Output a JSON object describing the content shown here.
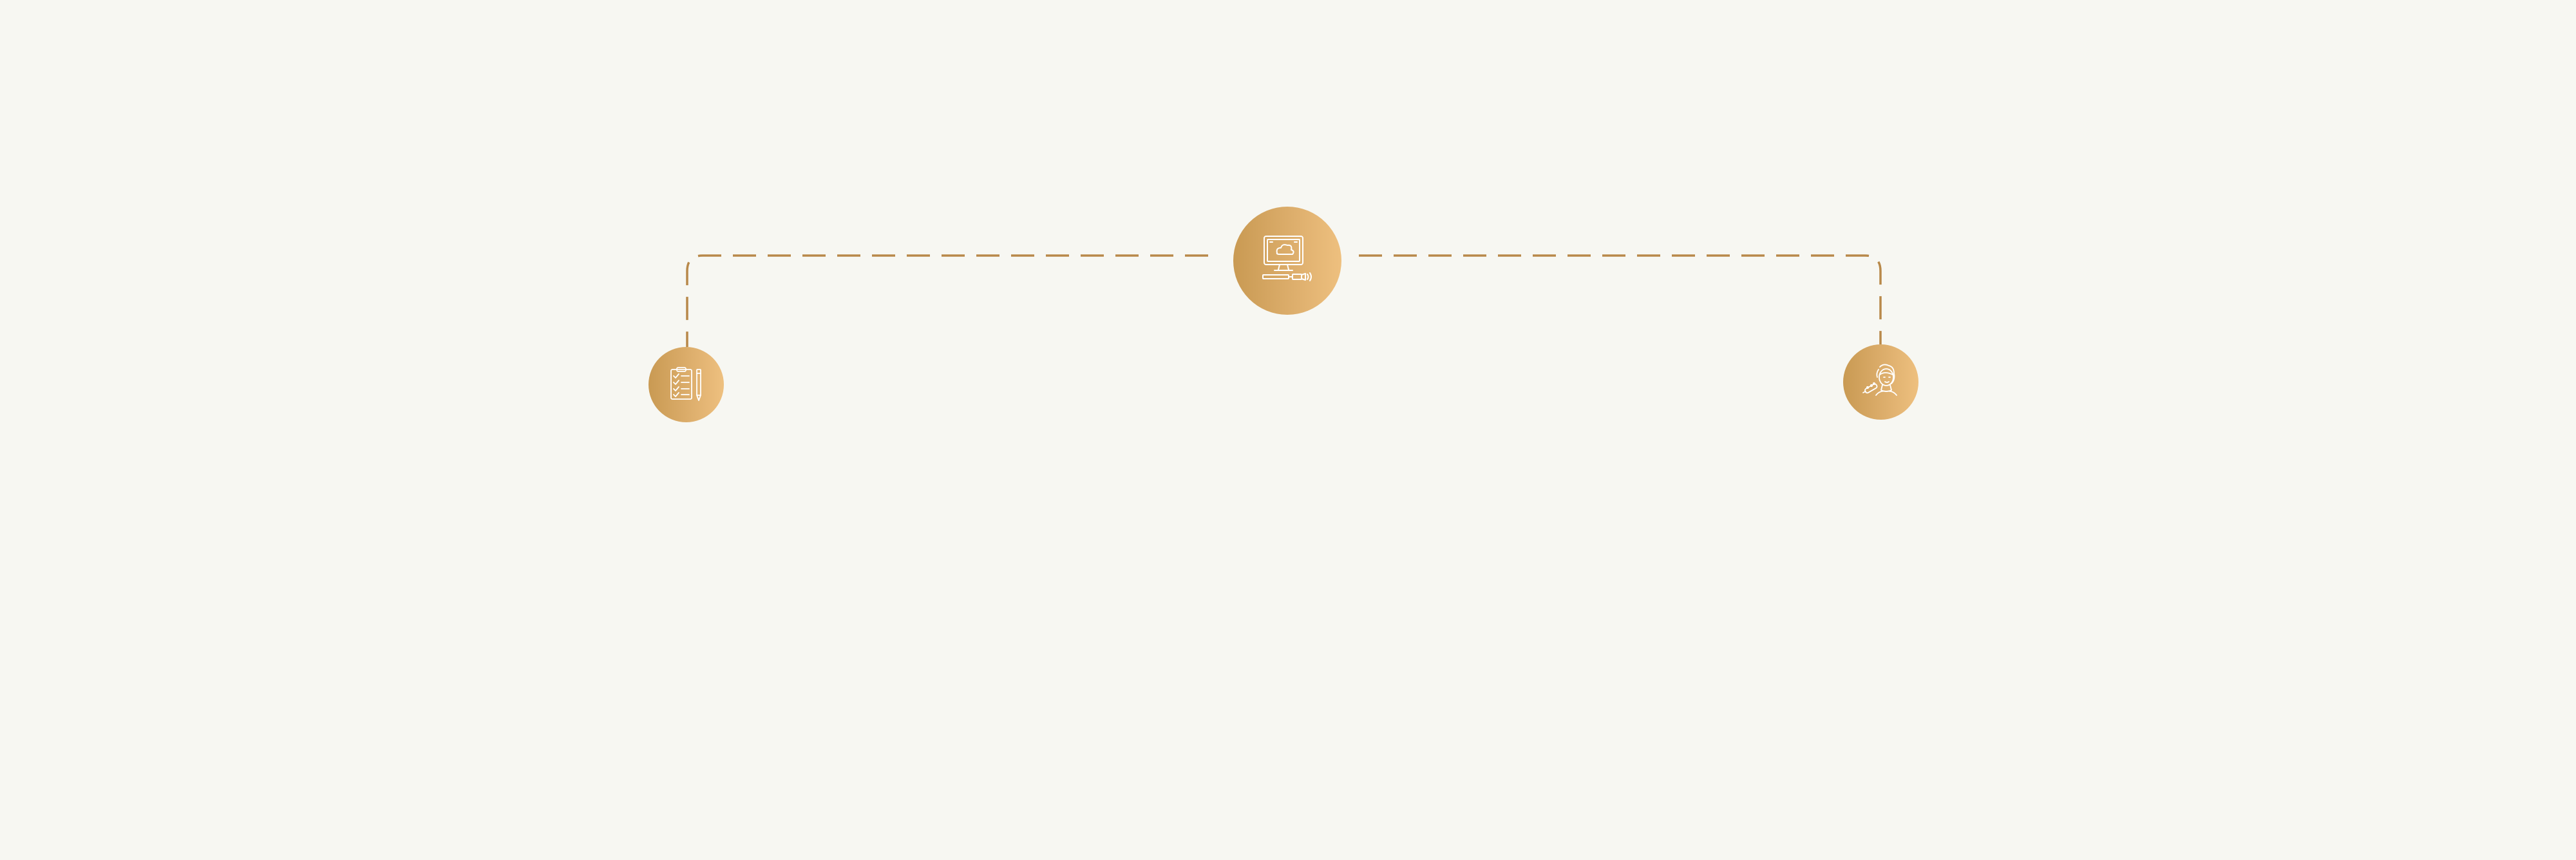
{
  "colors": {
    "background": "#f7f7f2",
    "connector": "#b8894a",
    "node_gradient_start": "#c99a53",
    "node_gradient_end": "#eec07f",
    "icon_stroke": "#ffffff"
  },
  "nodes": [
    {
      "id": "center",
      "icon": "computer-ultrasound-icon"
    },
    {
      "id": "left",
      "icon": "checklist-clipboard-icon"
    },
    {
      "id": "right",
      "icon": "facial-treatment-icon"
    }
  ],
  "connector": {
    "style": "dashed"
  }
}
